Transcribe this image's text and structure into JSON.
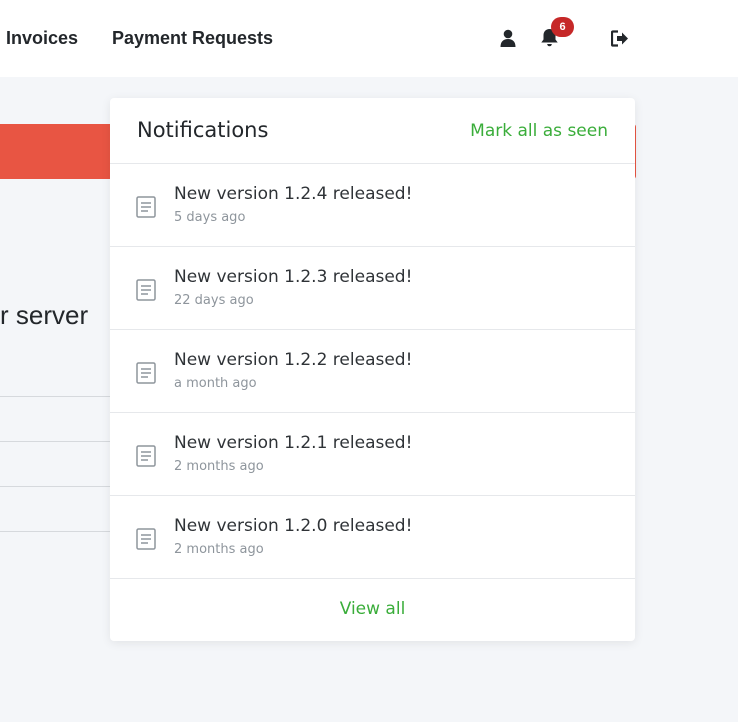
{
  "navbar": {
    "links": [
      {
        "label": "Invoices"
      },
      {
        "label": "Payment Requests"
      }
    ],
    "icons": {
      "user": "user-icon",
      "bell": "bell-icon",
      "logout": "logout-icon"
    },
    "notification_count": "6"
  },
  "background": {
    "heading_fragment": "r server",
    "banner_color": "#e85543"
  },
  "notifications": {
    "title": "Notifications",
    "mark_all_label": "Mark all as seen",
    "items": [
      {
        "title": "New version 1.2.4 released!",
        "time": "5 days ago"
      },
      {
        "title": "New version 1.2.3 released!",
        "time": "22 days ago"
      },
      {
        "title": "New version 1.2.2 released!",
        "time": "a month ago"
      },
      {
        "title": "New version 1.2.1 released!",
        "time": "2 months ago"
      },
      {
        "title": "New version 1.2.0 released!",
        "time": "2 months ago"
      }
    ],
    "item_icon": "document-icon",
    "view_all_label": "View all"
  },
  "colors": {
    "accent_green": "#3aad3a",
    "badge_red": "#c62828"
  }
}
